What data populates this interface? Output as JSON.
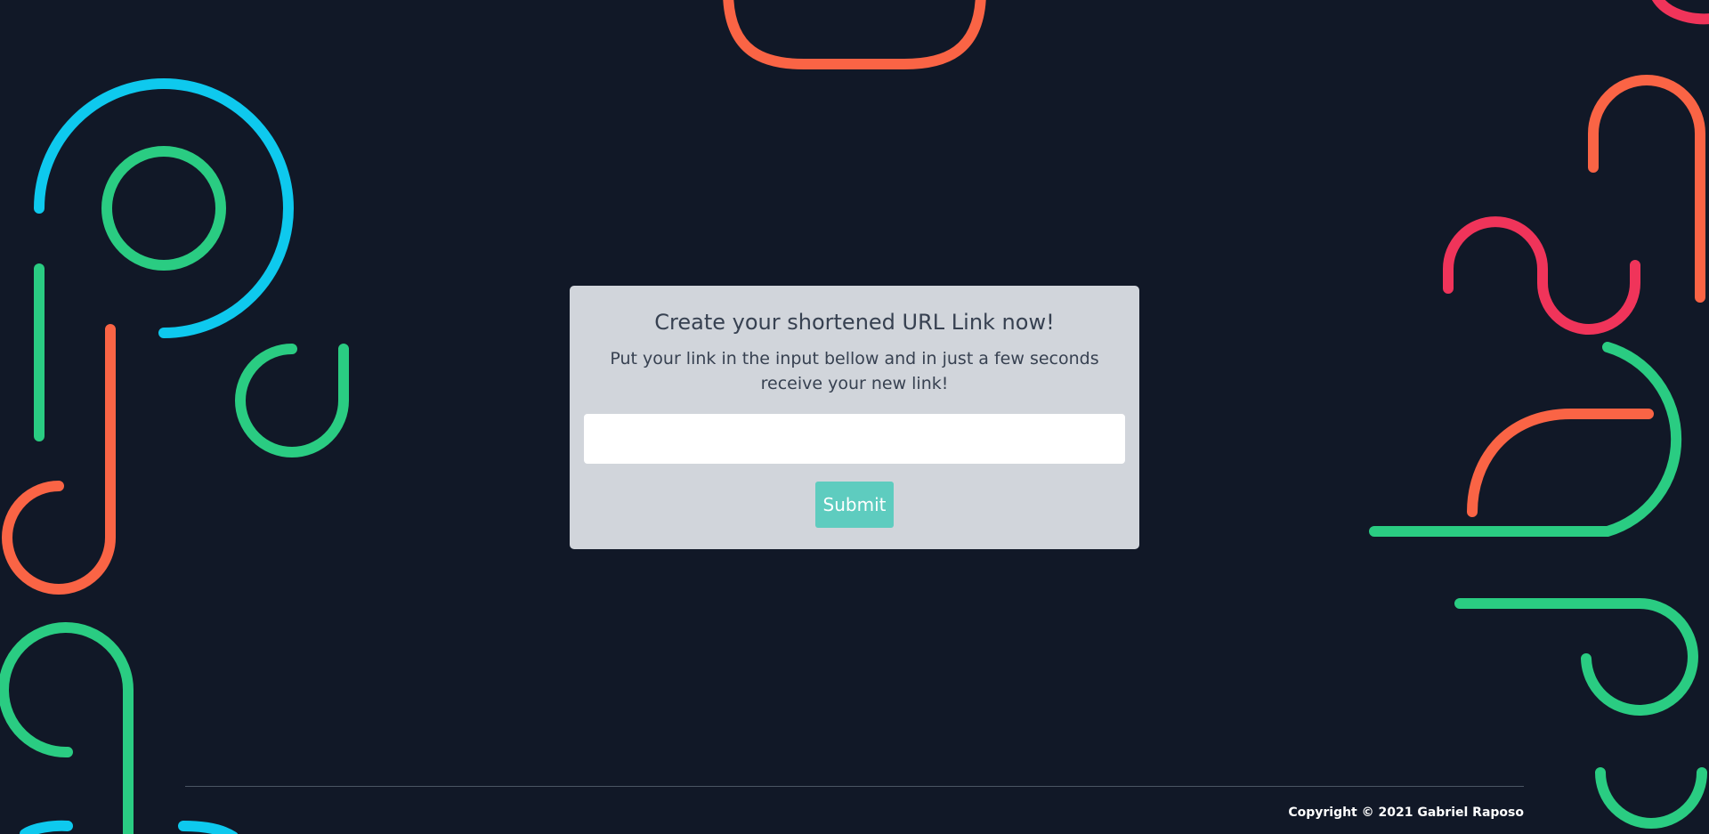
{
  "card": {
    "title": "Create your shortened URL Link now!",
    "description": "Put your link in the input bellow and in just a few seconds receive your new link!",
    "input_value": "",
    "input_placeholder": "",
    "submit_label": "Submit"
  },
  "footer": {
    "copyright": "Copyright © 2021 Gabriel Raposo"
  },
  "colors": {
    "background": "#111827",
    "card": "#d1d5db",
    "submit": "#5eccbf",
    "shape_blue": "#0ec9ee",
    "shape_green": "#2acc82",
    "shape_orange": "#fa6445",
    "shape_pink": "#f0345a"
  }
}
